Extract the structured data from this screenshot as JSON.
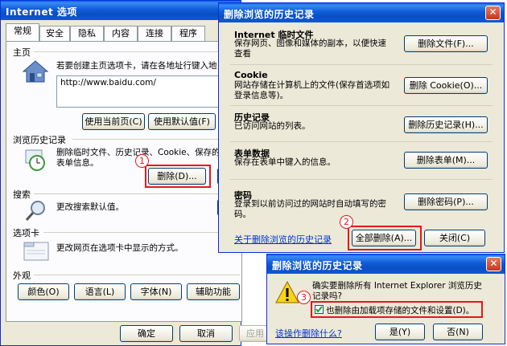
{
  "ie_options": {
    "title": "Internet 选项",
    "tabs": [
      "常规",
      "安全",
      "隐私",
      "内容",
      "连接",
      "程序"
    ],
    "homepage": {
      "heading": "主页",
      "desc": "若要创建主页选项卡，请在各地址行键入地",
      "url": "http://www.baidu.com/",
      "btn_current": "使用当前页(C)",
      "btn_default": "使用默认值(F)"
    },
    "history": {
      "heading": "浏览历史记录",
      "desc_line1": "删除临时文件、历史记录、Cookie、保存的",
      "desc_line2": "表单信息。",
      "btn_delete": "删除(D)..."
    },
    "search": {
      "heading": "搜索",
      "desc": "更改搜索默认值。"
    },
    "tabs_group": {
      "heading": "选项卡",
      "desc": "更改网页在选项卡中显示的方式。"
    },
    "appearance": {
      "heading": "外观",
      "btn_colors": "颜色(O)",
      "btn_languages": "语言(L)",
      "btn_fonts": "字体(N)",
      "btn_accessibility": "辅助功能"
    },
    "footer": {
      "ok": "确定",
      "cancel": "取消",
      "apply": "应用"
    }
  },
  "delete_history": {
    "title": "删除浏览的历史记录",
    "sections": [
      {
        "title": "Internet 临时文件",
        "desc_line1": "保存网页、图像和媒体的副本，以便快速",
        "desc_line2": "查看",
        "button": "删除文件(F)..."
      },
      {
        "title": "Cookie",
        "desc_line1": "网站存储在计算机上的文件(保存首选项如",
        "desc_line2": "登录信息等)。",
        "button": "删除 Cookie(O)..."
      },
      {
        "title": "历史记录",
        "desc_line1": "已访问网站的列表。",
        "desc_line2": "",
        "button": "删除历史记录(H)..."
      },
      {
        "title": "表单数据",
        "desc_line1": "保存在表单中键入的信息。",
        "desc_line2": "",
        "button": "删除表单(M)..."
      },
      {
        "title": "密码",
        "desc_line1": "登录到以前访问过的网站时自动填写的密",
        "desc_line2": "码。",
        "button": "删除密码(P)..."
      }
    ],
    "about_link": "关于删除浏览的历史记录",
    "btn_delete_all": "全部删除(A)...",
    "btn_close": "关闭(C)"
  },
  "confirm": {
    "title": "删除浏览的历史记录",
    "message_line1": "确实要删除所有 Internet Explorer 浏览历史",
    "message_line2": "记录吗?",
    "checkbox_label": "也删除由加载项存储的文件和设置(D)。",
    "checkbox_checked": true,
    "help_link": "该操作删除什么?",
    "btn_yes": "是(Y)",
    "btn_no": "否(N)"
  },
  "annotations": {
    "n1": "1",
    "n2": "2",
    "n3": "3"
  },
  "accent_red": "#e8161c",
  "xp_blue": "#0a4fc4"
}
